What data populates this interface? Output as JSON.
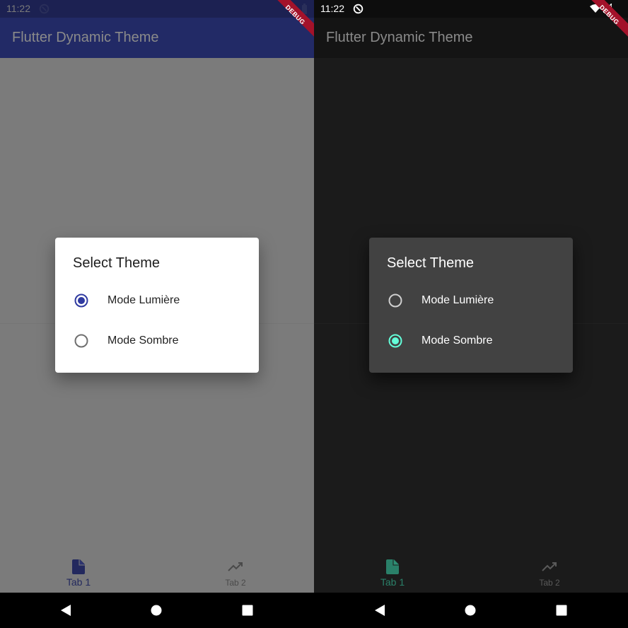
{
  "colors": {
    "light_primary": "#2f3aa0",
    "light_appbar": "#222a66",
    "light_scrim": "#7b7b7b",
    "dark_accent": "#64ffda",
    "dark_appbar": "#141414",
    "dark_background": "#1b1b1b",
    "dialog_light": "#ffffff",
    "dialog_dark": "#424242"
  },
  "screens": [
    {
      "theme": "light",
      "status_time": "11:22",
      "app_title": "Flutter Dynamic Theme",
      "debug_banner": "DEBUG",
      "dialog": {
        "title": "Select Theme",
        "options": [
          {
            "label": "Mode Lumière",
            "selected": true
          },
          {
            "label": "Mode Sombre",
            "selected": false
          }
        ]
      },
      "bottom_nav": [
        {
          "label": "Tab 1",
          "icon": "file-icon",
          "active": true
        },
        {
          "label": "Tab 2",
          "icon": "trending-up-icon",
          "active": false
        }
      ]
    },
    {
      "theme": "dark",
      "status_time": "11:22",
      "app_title": "Flutter Dynamic Theme",
      "debug_banner": "DEBUG",
      "dialog": {
        "title": "Select Theme",
        "options": [
          {
            "label": "Mode Lumière",
            "selected": false
          },
          {
            "label": "Mode Sombre",
            "selected": true
          }
        ]
      },
      "bottom_nav": [
        {
          "label": "Tab 1",
          "icon": "file-icon",
          "active": true
        },
        {
          "label": "Tab 2",
          "icon": "trending-up-icon",
          "active": false
        }
      ]
    }
  ],
  "system_nav": {
    "icons": [
      "back-icon",
      "home-icon",
      "recents-icon"
    ]
  }
}
